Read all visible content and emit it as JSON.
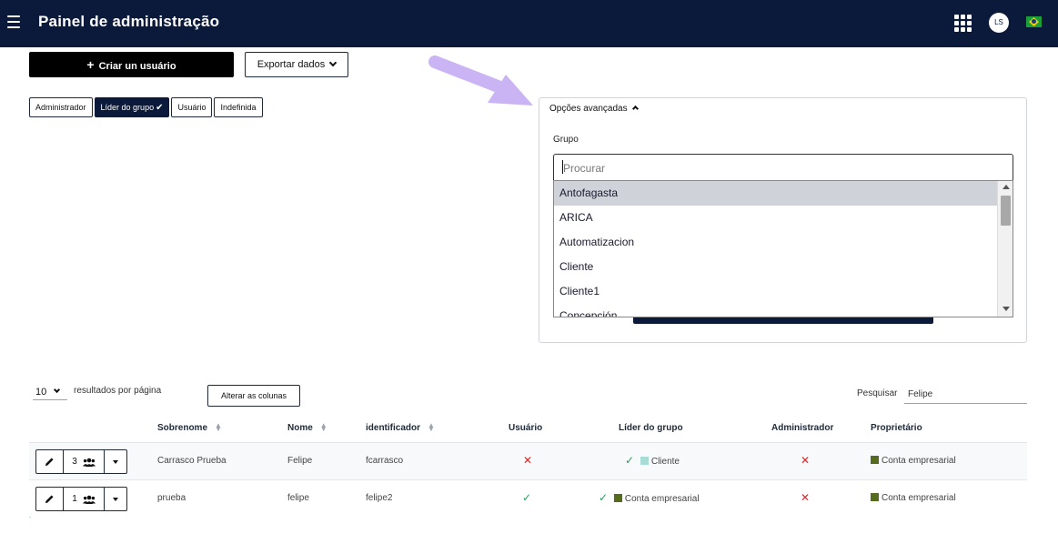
{
  "header": {
    "title": "Painel de administração",
    "avatar_initials": "LS",
    "bg_color": "#0b1a3a"
  },
  "toolbar": {
    "create_label": "Criar un usuário",
    "export_label": "Exportar dados"
  },
  "roles": [
    {
      "label": "Administrador",
      "active": false
    },
    {
      "label": "Líder do grupo",
      "active": true
    },
    {
      "label": "Usuário",
      "active": false
    },
    {
      "label": "Indefinida",
      "active": false
    }
  ],
  "advanced": {
    "toggle_label": "Opções avançadas",
    "group_label": "Grupo",
    "search_placeholder": "Procurar",
    "options": [
      "Antofagasta",
      "ARICA",
      "Automatizacion",
      "Cliente",
      "Cliente1",
      "Concepción"
    ],
    "highlighted_index": 0
  },
  "table_controls": {
    "page_size": "10",
    "per_page_label": "resultados por página",
    "columns_button": "Alterar as colunas",
    "search_label": "Pesquisar",
    "search_value": "Felipe"
  },
  "columns": {
    "surname": "Sobrenome",
    "name": "Nome",
    "identifier": "identificador",
    "user": "Usuário",
    "group_leader": "Líder do grupo",
    "admin": "Administrador",
    "owner": "Proprietário"
  },
  "rows": [
    {
      "group_count": "3",
      "surname": "Carrasco Prueba",
      "name": "Felipe",
      "identifier": "fcarrasco",
      "user": false,
      "group_leader": true,
      "group_leader_label": "Cliente",
      "group_leader_color": "#a7dcd6",
      "admin": false,
      "owner": "Conta empresarial",
      "owner_color": "#556b1e"
    },
    {
      "group_count": "1",
      "surname": "prueba",
      "name": "felipe",
      "identifier": "felipe2",
      "user": true,
      "group_leader": true,
      "group_leader_label": "Conta empresarial",
      "group_leader_color": "#556b1e",
      "admin": false,
      "owner": "Conta empresarial",
      "owner_color": "#556b1e"
    }
  ],
  "icons": {
    "menu": "hamburger-icon",
    "apps": "apps-grid-icon",
    "flag": "brazil-flag-icon",
    "edit": "pencil-icon",
    "group": "users-icon",
    "yes": "check-icon",
    "no": "x-icon"
  }
}
